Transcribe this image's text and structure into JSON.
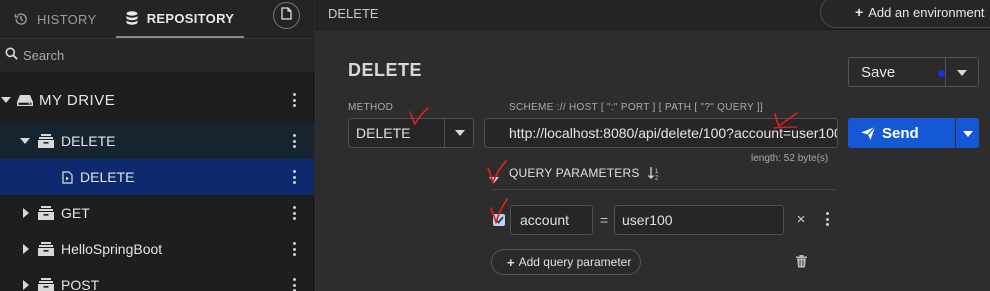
{
  "sidebar": {
    "tabs": [
      {
        "label": "HISTORY",
        "icon": "history-icon"
      },
      {
        "label": "REPOSITORY",
        "icon": "database-icon",
        "active": true
      }
    ],
    "new_file_icon": "new-file-icon",
    "search": {
      "placeholder": "Search",
      "value": ""
    },
    "tree": [
      {
        "label": "MY DRIVE",
        "icon": "drive-icon",
        "expanded": true
      },
      {
        "label": "DELETE",
        "icon": "folder-icon",
        "expanded": true
      },
      {
        "label": "DELETE",
        "icon": "request-file-icon",
        "selected": true
      },
      {
        "label": "GET",
        "icon": "folder-icon",
        "expanded": false
      },
      {
        "label": "HelloSpringBoot",
        "icon": "folder-icon",
        "expanded": false
      },
      {
        "label": "POST",
        "icon": "folder-icon",
        "expanded": false
      }
    ]
  },
  "header": {
    "title": "DELETE",
    "add_environment": "Add an environment"
  },
  "request": {
    "title": "DELETE",
    "save_label": "Save",
    "method_label": "METHOD",
    "method": "DELETE",
    "url_label": "SCHEME :// HOST [ \":\" PORT ] [ PATH [ \"?\" QUERY ]]",
    "url": "http://localhost:8080/api/delete/100?account=user100",
    "length": "length: 52 byte(s)",
    "send_label": "Send"
  },
  "query_params": {
    "title": "QUERY PARAMETERS",
    "params": [
      {
        "enabled": true,
        "key": "account",
        "eq": "=",
        "value": "user100"
      }
    ],
    "add_label": "Add query parameter"
  },
  "colors": {
    "accent": "#1558d6",
    "selected_row": "#0d2a6e",
    "annotation": "#e0201a"
  }
}
